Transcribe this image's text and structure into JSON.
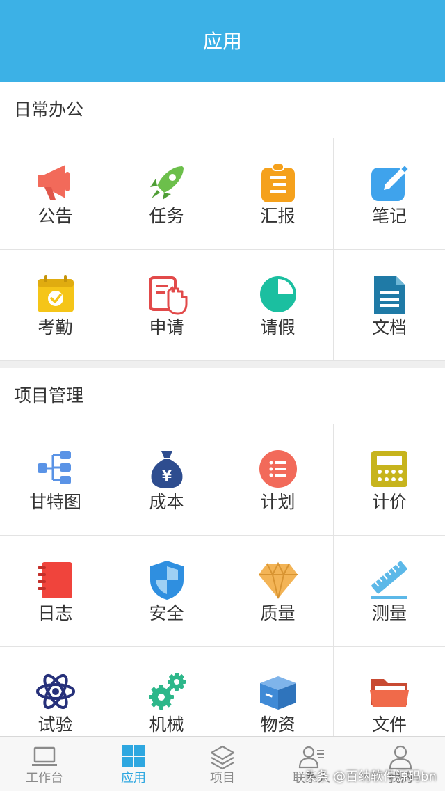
{
  "header": {
    "title": "应用"
  },
  "sections": [
    {
      "title": "日常办公",
      "items": [
        {
          "label": "公告",
          "icon": "megaphone-icon",
          "color": "#f26a5a"
        },
        {
          "label": "任务",
          "icon": "rocket-icon",
          "color": "#6cbf4b"
        },
        {
          "label": "汇报",
          "icon": "clipboard-icon",
          "color": "#f5a11c"
        },
        {
          "label": "笔记",
          "icon": "note-edit-icon",
          "color": "#3fa3ec"
        },
        {
          "label": "考勤",
          "icon": "calendar-check-icon",
          "color": "#f5c518"
        },
        {
          "label": "申请",
          "icon": "hand-document-icon",
          "color": "#e24a4a"
        },
        {
          "label": "请假",
          "icon": "pie-clock-icon",
          "color": "#1bbfa0"
        },
        {
          "label": "文档",
          "icon": "document-icon",
          "color": "#1f7aa6"
        }
      ]
    },
    {
      "title": "项目管理",
      "items": [
        {
          "label": "甘特图",
          "icon": "gantt-tree-icon",
          "color": "#5a93e6"
        },
        {
          "label": "成本",
          "icon": "money-bag-icon",
          "color": "#2e4d8f"
        },
        {
          "label": "计划",
          "icon": "list-circle-icon",
          "color": "#f26a5a"
        },
        {
          "label": "计价",
          "icon": "calculator-icon",
          "color": "#c7b41d"
        },
        {
          "label": "日志",
          "icon": "notebook-icon",
          "color": "#f0443c"
        },
        {
          "label": "安全",
          "icon": "shield-icon",
          "color": "#2f8fe0"
        },
        {
          "label": "质量",
          "icon": "diamond-icon",
          "color": "#f3b456"
        },
        {
          "label": "测量",
          "icon": "ruler-icon",
          "color": "#5cb8e8"
        },
        {
          "label": "试验",
          "icon": "atom-icon",
          "color": "#26307a"
        },
        {
          "label": "机械",
          "icon": "gears-icon",
          "color": "#2db78a"
        },
        {
          "label": "物资",
          "icon": "box-icon",
          "color": "#3f8ad6"
        },
        {
          "label": "文件",
          "icon": "folder-icon",
          "color": "#f06a4a"
        }
      ]
    }
  ],
  "tabbar": [
    {
      "label": "工作台",
      "icon": "laptop-icon",
      "active": false
    },
    {
      "label": "应用",
      "icon": "grid-icon",
      "active": true
    },
    {
      "label": "项目",
      "icon": "layers-icon",
      "active": false
    },
    {
      "label": "联系人",
      "icon": "contacts-icon",
      "active": false
    },
    {
      "label": "我的",
      "icon": "user-icon",
      "active": false
    }
  ],
  "colors": {
    "header": "#3cb1e6",
    "active_tab": "#2ea7e0",
    "inactive_tab": "#8a8a8a"
  },
  "watermark": "头条 @百纳软件源码bn"
}
